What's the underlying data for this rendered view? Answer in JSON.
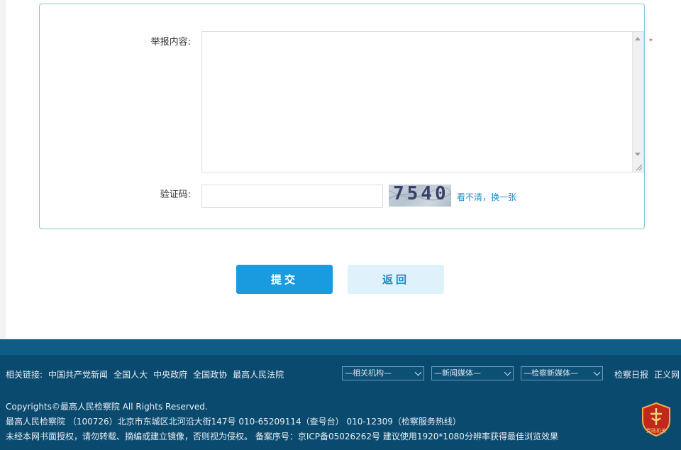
{
  "form": {
    "content_label": "举报内容:",
    "required_mark": "*",
    "captcha_label": "验证码:",
    "captcha_value": "",
    "captcha_image_text": "7540",
    "refresh_link": "看不清，换一张"
  },
  "actions": {
    "submit": "提交",
    "back": "返回"
  },
  "footer": {
    "links_label": "相关链接:",
    "links": [
      "中国共产党新闻",
      "全国人大",
      "中央政府",
      "全国政协",
      "最高人民法院"
    ],
    "selects": [
      "—相关机构—",
      "—新闻媒体—",
      "—检察新媒体—"
    ],
    "right_links": [
      "检察日报",
      "正义网"
    ],
    "copyright": "Copyrights©最高人民检察院 All Rights Reserved.",
    "address": "最高人民检察院 （100726）北京市东城区北河沿大街147号 010-65209114（查号台） 010-12309（检察服务热线）",
    "notice": "未经本网书面授权，请勿转载、摘编或建立镜像，否则视为侵权。 备案序号：京ICP备05026262号   建议使用1920*1080分辨率获得最佳浏览效果",
    "badge_text": "党政机关"
  }
}
